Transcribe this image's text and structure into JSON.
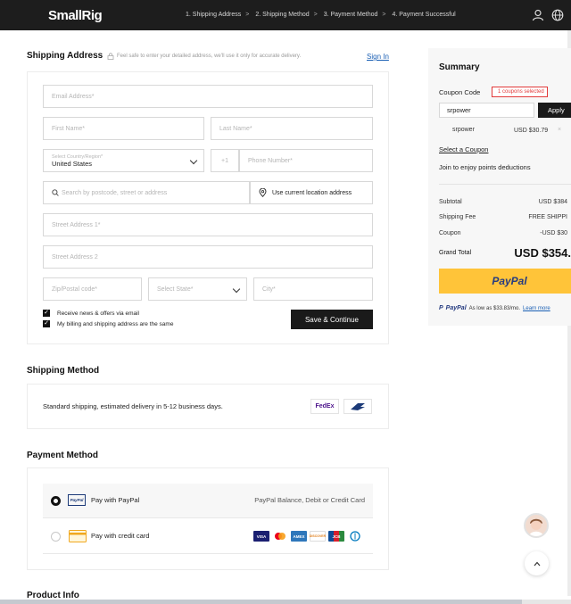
{
  "header": {
    "brand": "SmallRig",
    "steps": [
      "1. Shipping Address",
      "2. Shipping Method",
      "3. Payment Method",
      "4. Payment Successful"
    ],
    "step_separator": ">",
    "user_icon": "user-icon",
    "language_icon": "globe-icon"
  },
  "shipping_address": {
    "title": "Shipping Address",
    "hint": "Feel safe to enter your detailed address, we'll use it only for accurate delivery.",
    "sign_in": "Sign In",
    "fields": {
      "email": "Email Address*",
      "first_name": "First Name*",
      "last_name": "Last Name*",
      "country_label": "Select Country/Region*",
      "country_value": "United States",
      "phone_code": "+1",
      "phone": "Phone Number*",
      "search": "Search by postcode, street or address",
      "use_location": "Use current location address",
      "street1": "Street Address 1*",
      "street2": "Street Address 2",
      "zip": "Zip/Postal code*",
      "state": "Select State*",
      "city": "City*"
    },
    "checkbox_news": "Receive news & offers via email",
    "checkbox_billing": "My billing and shipping address are the same",
    "continue": "Save & Continue"
  },
  "shipping_method": {
    "title": "Shipping Method",
    "description": "Standard shipping, estimated delivery in 5-12 business days.",
    "carriers": [
      "FedEx",
      "USPS"
    ]
  },
  "payment_method": {
    "title": "Payment Method",
    "options": [
      {
        "label": "Pay with PayPal",
        "detail": "PayPal Balance, Debit or Credit Card",
        "selected": true
      },
      {
        "label": "Pay with credit card",
        "detail": "",
        "selected": false
      }
    ],
    "card_brands": [
      "VISA",
      "Mastercard",
      "AMEX",
      "DISCOVER",
      "JCB",
      "Diners"
    ]
  },
  "product_info": {
    "title": "Product Info"
  },
  "summary": {
    "title": "Summary",
    "coupon_label": "Coupon Code",
    "coupon_badge": "1 coupons selected",
    "coupon_input": "srpower",
    "apply": "Apply",
    "applied_code": "srpower",
    "applied_amount": "USD $30.79",
    "remove": "×",
    "select_coupon": "Select a Coupon",
    "points_text": "Join to enjoy points deductions",
    "subtotal_label": "Subtotal",
    "subtotal_value": "USD $384",
    "shipping_label": "Shipping Fee",
    "shipping_value": "FREE SHIPPI",
    "coupon_row_label": "Coupon",
    "coupon_row_value": "-USD $30",
    "grand_total_label": "Grand Total",
    "grand_total_value": "USD $354.",
    "paypal_button": "PayPal",
    "paypal_note": "As low as $33.83/mo.",
    "learn_more": "Learn more"
  },
  "colors": {
    "header_bg": "#1d1d1d",
    "accent_red": "#e23a3a",
    "paypal_yellow": "#ffc439",
    "link_blue": "#1a5fb4"
  }
}
